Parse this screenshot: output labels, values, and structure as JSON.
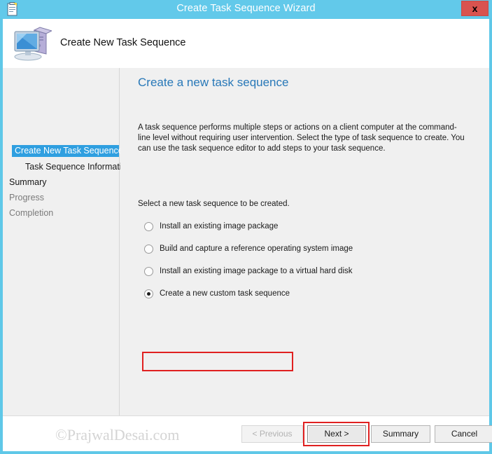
{
  "titlebar": {
    "title": "Create Task Sequence Wizard",
    "icon": "task-sequence-clipboard-icon",
    "close_label": "x",
    "accent_color": "#62c9ea",
    "close_color": "#d9534f"
  },
  "header": {
    "title": "Create New Task Sequence",
    "icon": "computer-icon"
  },
  "sidebar": {
    "items": [
      {
        "label": "Create New Task Sequence",
        "state": "selected",
        "indent": false
      },
      {
        "label": "Task Sequence Informati",
        "state": "sub",
        "indent": true
      },
      {
        "label": "Summary",
        "state": "bold",
        "indent": false
      },
      {
        "label": "Progress",
        "state": "dim",
        "indent": false
      },
      {
        "label": "Completion",
        "state": "dim",
        "indent": false
      }
    ],
    "selection_color": "#2f9fe0",
    "scrollbar": {
      "left_arrow": "‹",
      "right_arrow": "›",
      "grip": "|||"
    }
  },
  "main": {
    "heading": "Create a new task sequence",
    "heading_color": "#2878b8",
    "description": "A task sequence performs multiple steps or actions on a client computer at the command-line level without requiring user intervention. Select the type of task sequence to create. You can use the task sequence editor to add steps to your task sequence.",
    "select_prompt": "Select a new task sequence to be created.",
    "options": [
      {
        "label": "Install an existing image package",
        "checked": false
      },
      {
        "label": "Build and capture a reference operating system image",
        "checked": false
      },
      {
        "label": "Install an existing image package to a virtual hard disk",
        "checked": false
      },
      {
        "label": "Create a new custom task sequence",
        "checked": true
      }
    ],
    "highlight_color": "#e02020"
  },
  "footer": {
    "previous_label": "< Previous",
    "next_label": "Next >",
    "summary_label": "Summary",
    "cancel_label": "Cancel",
    "watermark": "©PrajwalDesai.com"
  }
}
